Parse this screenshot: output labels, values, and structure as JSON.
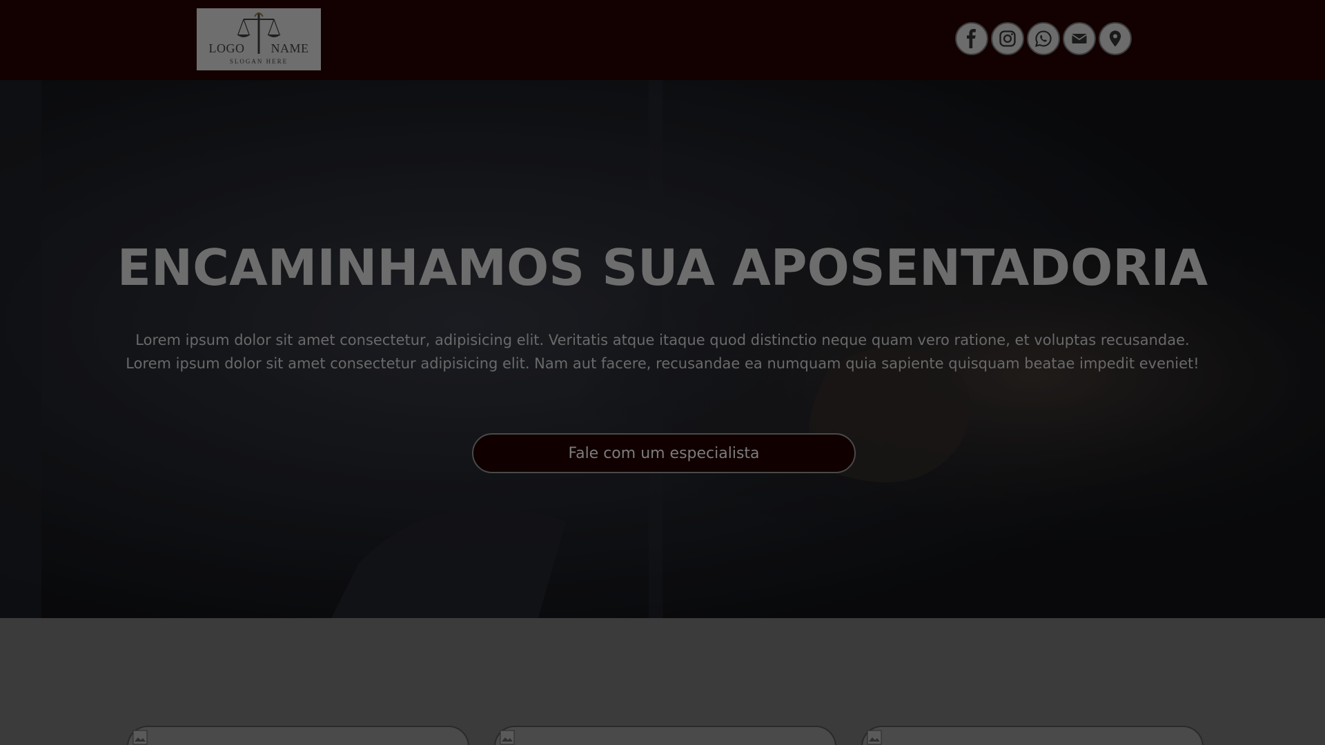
{
  "header": {
    "logo": {
      "word1": "LOGO",
      "word2": "NAME",
      "slogan": "SLOGAN HERE",
      "icon": "scales-of-justice-icon"
    },
    "social": [
      {
        "name": "facebook",
        "icon": "facebook-icon"
      },
      {
        "name": "instagram",
        "icon": "instagram-icon"
      },
      {
        "name": "whatsapp",
        "icon": "whatsapp-icon"
      },
      {
        "name": "email",
        "icon": "mail-icon"
      },
      {
        "name": "location",
        "icon": "map-pin-icon"
      }
    ]
  },
  "hero": {
    "title": "ENCAMINHAMOS SUA APOSENTADORIA",
    "text": "Lorem ipsum dolor sit amet consectetur, adipisicing elit. Veritatis atque itaque quod distinctio neque quam vero ratione, et voluptas recusandae. Lorem ipsum dolor sit amet consectetur adipisicing elit. Nam aut facere, recusandae ea numquam quia sapiente quisquam beatae impedit eveniet!",
    "cta_label": "Fale com um especialista"
  },
  "cards": [
    {
      "icon": "broken-image-icon"
    },
    {
      "icon": "broken-image-icon"
    },
    {
      "icon": "broken-image-icon"
    }
  ],
  "colors": {
    "header_bg": "#130000",
    "cta_bg": "#110000",
    "overlay": "#3b3b3b"
  }
}
